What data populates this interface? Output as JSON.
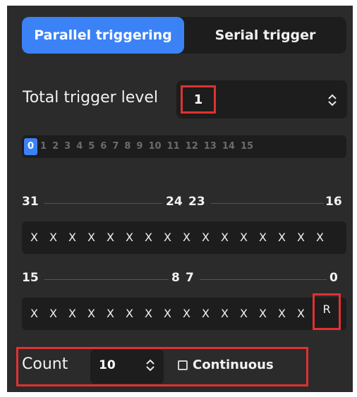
{
  "tabs": {
    "parallel": "Parallel triggering",
    "serial": "Serial trigger",
    "active": "parallel"
  },
  "total_trigger": {
    "label": "Total trigger level",
    "value": "1"
  },
  "levels": [
    "0",
    "1",
    "2",
    "3",
    "4",
    "5",
    "6",
    "7",
    "8",
    "9",
    "10",
    "11",
    "12",
    "13",
    "14",
    "15"
  ],
  "selected_level": "0",
  "upper_bits": {
    "labels": {
      "left": "31",
      "mid_left": "24",
      "mid_right": "23",
      "right": "16"
    },
    "values": [
      "X",
      "X",
      "X",
      "X",
      "X",
      "X",
      "X",
      "X",
      "X",
      "X",
      "X",
      "X",
      "X",
      "X",
      "X",
      "X"
    ]
  },
  "lower_bits": {
    "labels": {
      "left": "15",
      "mid_left": "8",
      "mid_right": "7",
      "right": "0"
    },
    "values": [
      "X",
      "X",
      "X",
      "X",
      "X",
      "X",
      "X",
      "X",
      "X",
      "X",
      "X",
      "X",
      "X",
      "X",
      "X",
      "R"
    ]
  },
  "count": {
    "label": "Count",
    "value": "10",
    "continuous_label": "Continuous",
    "continuous_checked": false
  },
  "colors": {
    "accent": "#3b82f6",
    "highlight": "#e03131",
    "panel": "#2b2b2b",
    "field": "#1d1d1d"
  }
}
